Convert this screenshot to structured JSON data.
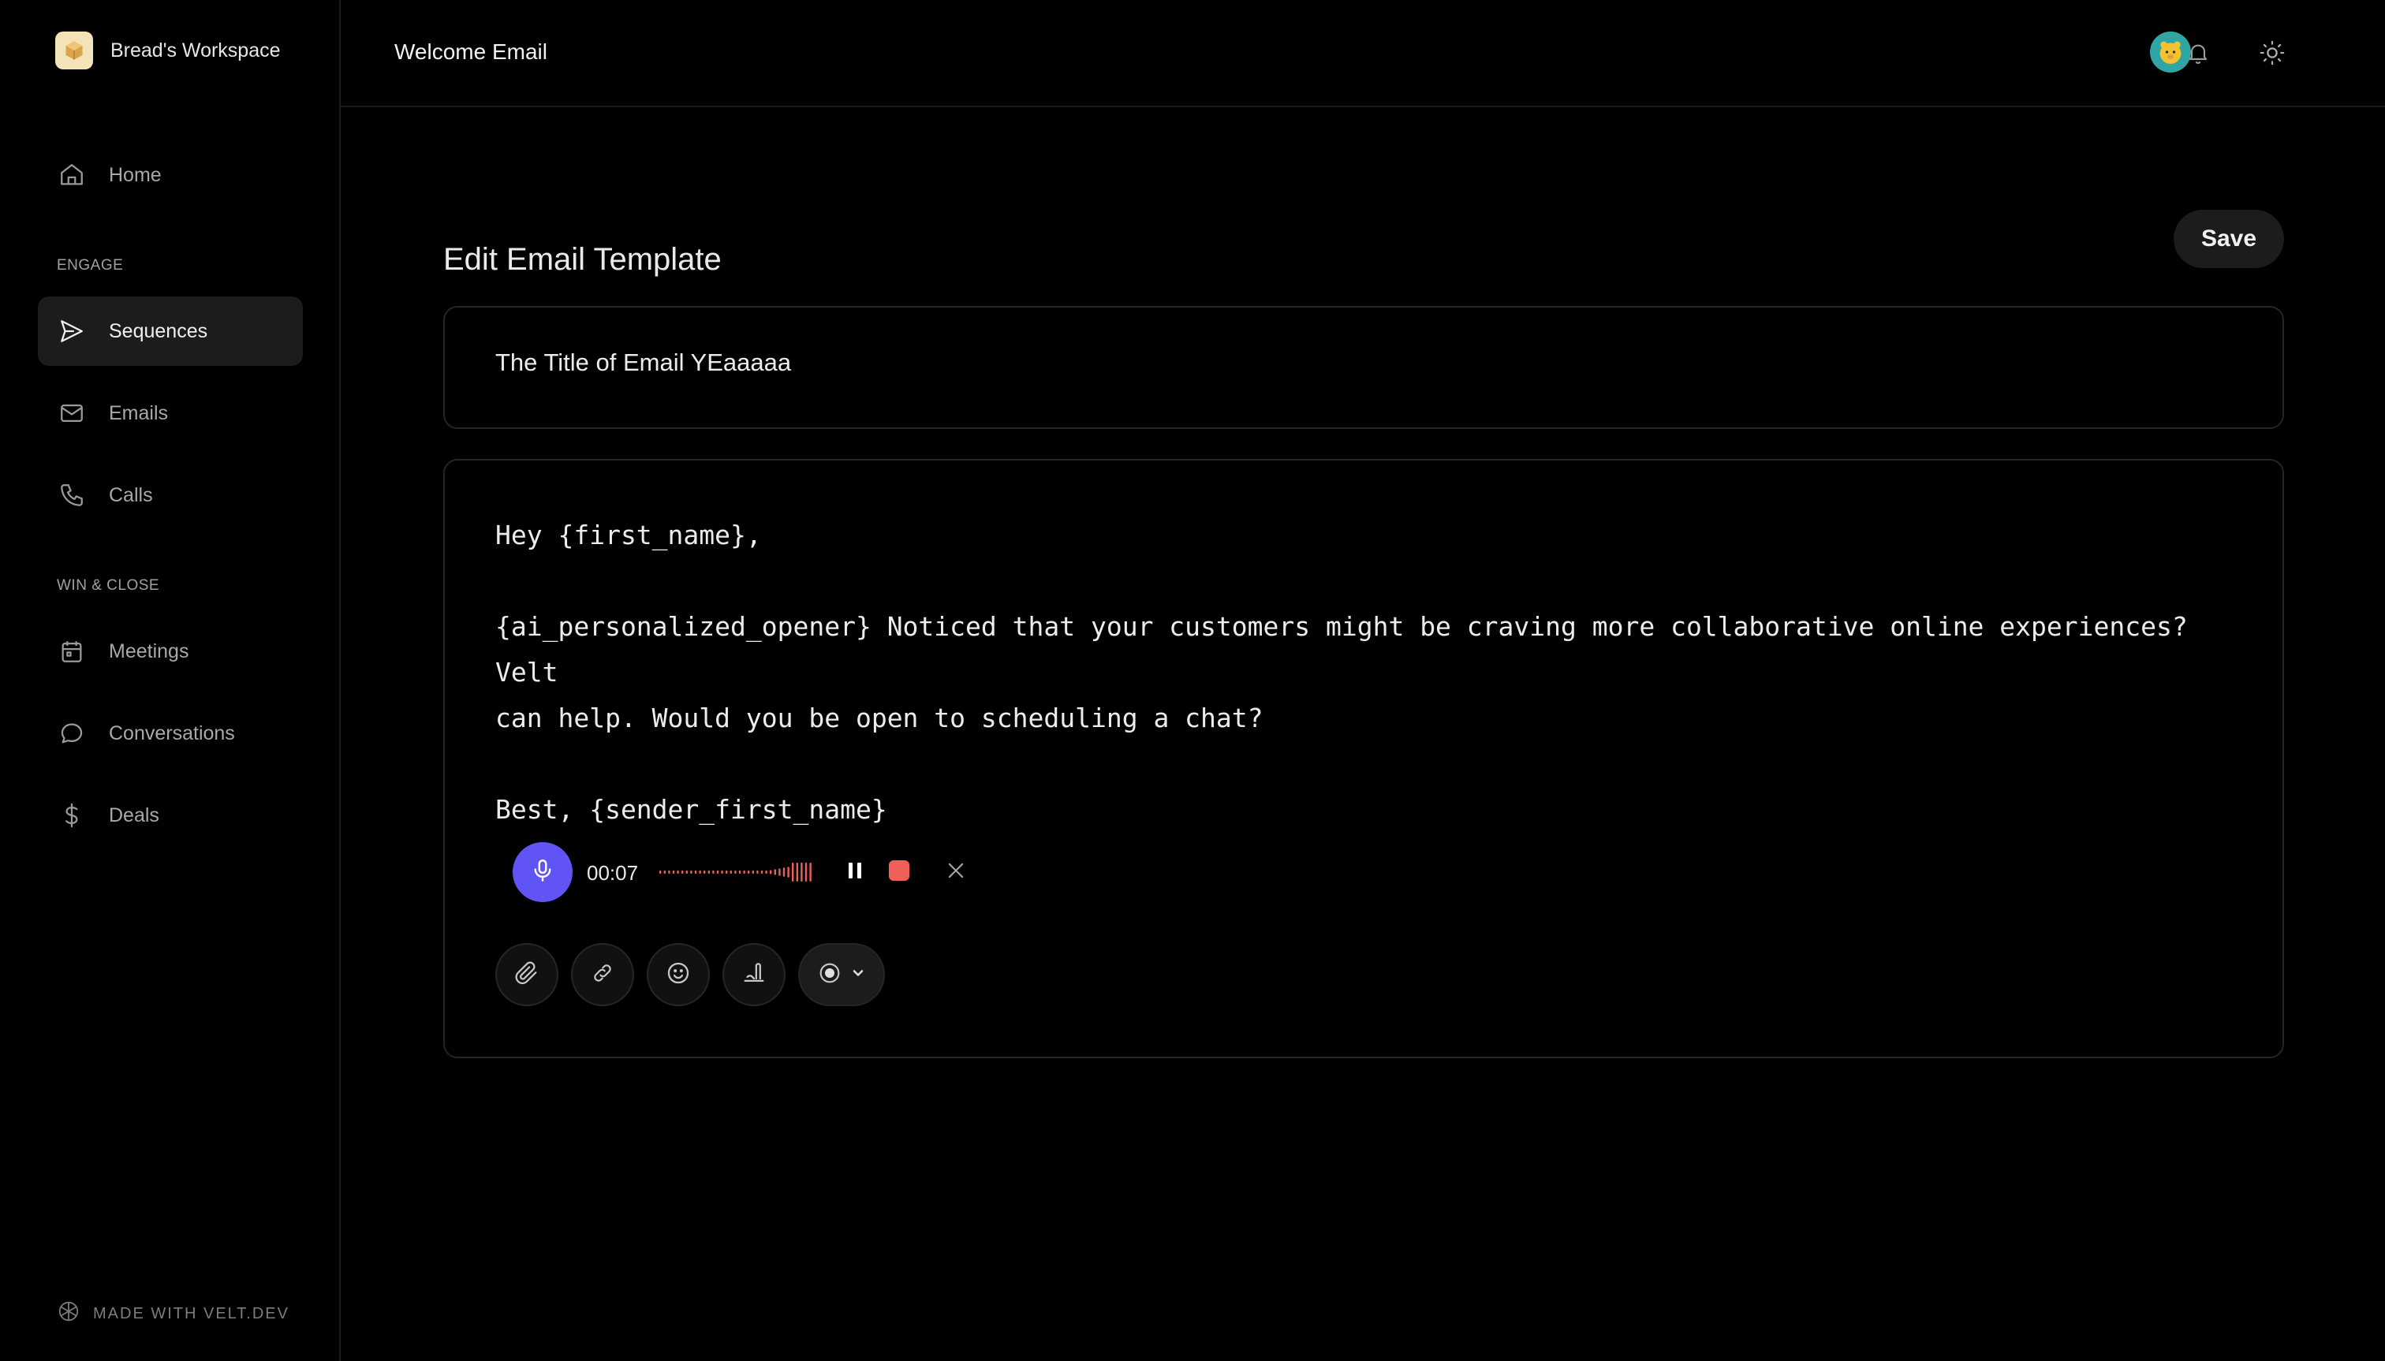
{
  "workspace": {
    "name": "Bread's Workspace",
    "logo_icon": "box-icon"
  },
  "sidebar": {
    "home": {
      "label": "Home",
      "icon": "home-icon"
    },
    "sections": {
      "engage": "ENGAGE",
      "win_close": "WIN & CLOSE"
    },
    "items": [
      {
        "label": "Sequences",
        "icon": "send-icon",
        "active": true
      },
      {
        "label": "Emails",
        "icon": "mail-icon"
      },
      {
        "label": "Calls",
        "icon": "phone-icon"
      },
      {
        "label": "Meetings",
        "icon": "calendar-icon"
      },
      {
        "label": "Conversations",
        "icon": "chat-icon"
      },
      {
        "label": "Deals",
        "icon": "dollar-icon"
      }
    ],
    "footer": "MADE WITH VELT.DEV"
  },
  "header": {
    "title": "Welcome Email",
    "icons": [
      "avatar",
      "bell-icon",
      "sun-icon"
    ]
  },
  "main": {
    "heading": "Edit Email Template",
    "save_label": "Save",
    "subject": "The Title of Email YEaaaaa",
    "body": {
      "greeting": "Hey {first_name},",
      "paragraph_line1": "{ai_personalized_opener} Noticed that your customers might be craving more collaborative online experiences? Velt",
      "paragraph_line2": "can help. Would you be open to scheduling a chat?",
      "signoff": "Best, {sender_first_name}"
    },
    "recorder": {
      "time": "00:07",
      "accent_color": "#6154f5",
      "wave_color": "#f0605a",
      "controls": [
        "pause-icon",
        "stop-icon",
        "close-icon"
      ]
    },
    "toolbar": [
      "attach-icon",
      "link-icon",
      "emoji-icon",
      "signature-icon",
      "record-icon"
    ]
  }
}
